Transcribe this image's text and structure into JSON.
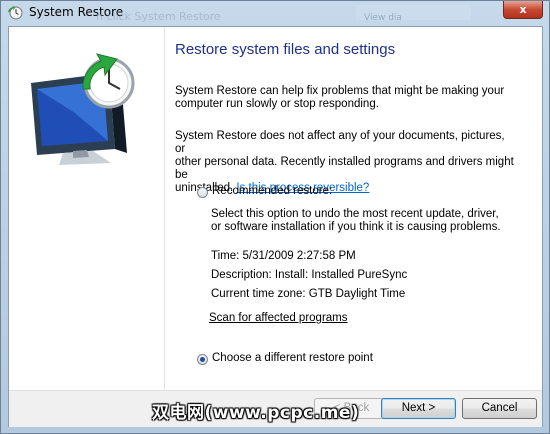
{
  "window": {
    "title": "System Restore",
    "close_label": "x",
    "background_title": "n click System Restore",
    "background_bar_text": "View dia"
  },
  "main": {
    "heading": "Restore system files and settings",
    "intro_line1": "System Restore can help fix problems that might be making your",
    "intro_line2": "computer run slowly or stop responding.",
    "info_line1": "System Restore does not affect any of your documents, pictures, or",
    "info_line2": "other personal data. Recently installed programs and drivers might be",
    "info_line3": "uninstalled.",
    "reversible_link": "Is this process reversible?",
    "recommended": {
      "label": "Recommended restore:",
      "selected": false,
      "desc_line1": "Select this option to undo the most recent update, driver,",
      "desc_line2": "or software installation if you think it is causing problems.",
      "time": "Time: 5/31/2009 2:27:58 PM",
      "description": "Description: Install: Installed PureSync",
      "timezone": "Current time zone: GTB Daylight Time",
      "scan_link": "Scan for affected programs"
    },
    "different": {
      "label": "Choose a different restore point",
      "selected": true
    }
  },
  "footer": {
    "back_label": "< Back",
    "next_label": "Next >",
    "cancel_label": "Cancel"
  },
  "watermark": "双电网(www.pcpc.me)",
  "colors": {
    "heading": "#1e3287",
    "link": "#0066cc",
    "close_button": "#c74a33"
  },
  "icons": {
    "title": "system-restore-icon",
    "hero": "monitor-clock-restore-icon"
  }
}
